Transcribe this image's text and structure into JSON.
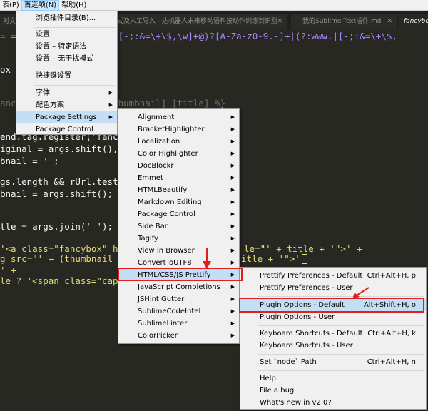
{
  "menubar": {
    "items": [
      "表(P)",
      "首选项(N)",
      "帮助(H)"
    ]
  },
  "tabs": [
    {
      "label": "对文档",
      "active": false
    },
    {
      "label": "载方式及人工导入 - 达机器人未来移动语料按动作训练到识别",
      "active": false
    },
    {
      "label": "我的Sublime-Text插件.md",
      "active": false
    },
    {
      "label": "fancybox",
      "active": true
    }
  ],
  "editor": {
    "lines": [
      "= /………………………/\\/)?(?:[-;:&=\\+\\$,\\w]+@)?[A-Za-z0-9.-]+|(?:www.|[-;:&=\\+\\$,",
      "ox t",
      "",
      "ancy…………………… path/to/thumbnail] [title] %}",
      "",
      "end.tag.register('fancyb",
      "iginal = args.shift(),",
      "bnail = '';",
      "",
      "gs.length && rUrl.test(a",
      "bnail = args.shift();",
      "",
      "",
      "tle = args.join(' ');",
      "",
      "'<a class=\"fancybox\" hr",
      "g src=\"' + (thumbnail ||",
      "' +",
      "le ? '<span class=\"capti"
    ],
    "right_fragments": {
      "line15": "le=\"' + title + '\">' +",
      "line16": "itle + '\">'"
    }
  },
  "menu_prefs": {
    "items": [
      "浏览插件目录(B)...",
      "设置",
      "设置 – 特定语法",
      "设置 – 无干扰模式",
      "快捷键设置",
      "字体",
      "配色方案",
      "Package Settings",
      "Package Control"
    ]
  },
  "menu_packages": {
    "items": [
      "Alignment",
      "BracketHighlighter",
      "Localization",
      "Color Highlighter",
      "DocBlockr",
      "Emmet",
      "HTMLBeautify",
      "Markdown Editing",
      "Package Control",
      "Side Bar",
      "Tagify",
      "View in Browser",
      "ConvertToUTF8",
      "HTML/CSS/JS Prettify",
      "JavaScript Completions",
      "JSHint Gutter",
      "SublimeCodeIntel",
      "SublimeLinter",
      "ColorPicker"
    ]
  },
  "menu_prettify": {
    "items": [
      {
        "label": "Prettify Preferences - Default",
        "shortcut": "Ctrl+Alt+H, p"
      },
      {
        "label": "Prettify Preferences - User",
        "shortcut": ""
      },
      {
        "label": "Plugin Options - Default",
        "shortcut": "Alt+Shift+H, o"
      },
      {
        "label": "Plugin Options - User",
        "shortcut": ""
      },
      {
        "label": "Keyboard Shortcuts - Default",
        "shortcut": "Ctrl+Alt+H, k"
      },
      {
        "label": "Keyboard Shortcuts - User",
        "shortcut": ""
      },
      {
        "label": "Set `node` Path",
        "shortcut": "Ctrl+Alt+H, n"
      },
      {
        "label": "Help",
        "shortcut": ""
      },
      {
        "label": "File a bug",
        "shortcut": ""
      },
      {
        "label": "What's new in v2.0?",
        "shortcut": ""
      }
    ]
  },
  "colors": {
    "annotation_red": "#e02020",
    "menu_highlight": "#c4def6",
    "editor_bg": "#272822"
  }
}
